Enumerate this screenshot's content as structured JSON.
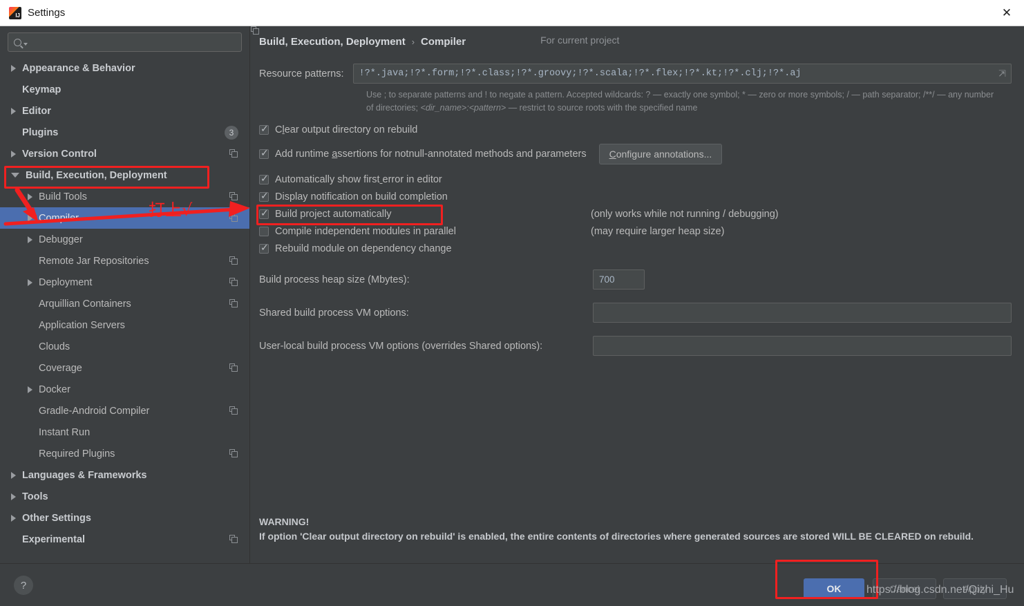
{
  "window": {
    "title": "Settings",
    "logo_icon": "intellij-idea-logo",
    "close_icon": "close-icon"
  },
  "sidebar": {
    "search": {
      "placeholder": "",
      "value": "",
      "icon": "search-icon"
    },
    "items": [
      {
        "label": "Appearance & Behavior",
        "indent": 0,
        "arrow": "right",
        "bold": true,
        "badge": null,
        "copy": false,
        "selected": false
      },
      {
        "label": "Keymap",
        "indent": 0,
        "arrow": "none",
        "bold": true,
        "badge": null,
        "copy": false,
        "selected": false
      },
      {
        "label": "Editor",
        "indent": 0,
        "arrow": "right",
        "bold": true,
        "badge": null,
        "copy": false,
        "selected": false
      },
      {
        "label": "Plugins",
        "indent": 0,
        "arrow": "none",
        "bold": true,
        "badge": "3",
        "copy": false,
        "selected": false
      },
      {
        "label": "Version Control",
        "indent": 0,
        "arrow": "right",
        "bold": true,
        "badge": null,
        "copy": true,
        "selected": false
      },
      {
        "label": "Build, Execution, Deployment",
        "indent": 0,
        "arrow": "down",
        "bold": true,
        "badge": null,
        "copy": false,
        "selected": false
      },
      {
        "label": "Build Tools",
        "indent": 1,
        "arrow": "right",
        "bold": false,
        "badge": null,
        "copy": true,
        "selected": false
      },
      {
        "label": "Compiler",
        "indent": 1,
        "arrow": "right",
        "bold": false,
        "badge": null,
        "copy": true,
        "selected": true
      },
      {
        "label": "Debugger",
        "indent": 1,
        "arrow": "right",
        "bold": false,
        "badge": null,
        "copy": false,
        "selected": false
      },
      {
        "label": "Remote Jar Repositories",
        "indent": 1,
        "arrow": "none",
        "bold": false,
        "badge": null,
        "copy": true,
        "selected": false
      },
      {
        "label": "Deployment",
        "indent": 1,
        "arrow": "right",
        "bold": false,
        "badge": null,
        "copy": true,
        "selected": false
      },
      {
        "label": "Arquillian Containers",
        "indent": 1,
        "arrow": "none",
        "bold": false,
        "badge": null,
        "copy": true,
        "selected": false
      },
      {
        "label": "Application Servers",
        "indent": 1,
        "arrow": "none",
        "bold": false,
        "badge": null,
        "copy": false,
        "selected": false
      },
      {
        "label": "Clouds",
        "indent": 1,
        "arrow": "none",
        "bold": false,
        "badge": null,
        "copy": false,
        "selected": false
      },
      {
        "label": "Coverage",
        "indent": 1,
        "arrow": "none",
        "bold": false,
        "badge": null,
        "copy": true,
        "selected": false
      },
      {
        "label": "Docker",
        "indent": 1,
        "arrow": "right",
        "bold": false,
        "badge": null,
        "copy": false,
        "selected": false
      },
      {
        "label": "Gradle-Android Compiler",
        "indent": 1,
        "arrow": "none",
        "bold": false,
        "badge": null,
        "copy": true,
        "selected": false
      },
      {
        "label": "Instant Run",
        "indent": 1,
        "arrow": "none",
        "bold": false,
        "badge": null,
        "copy": false,
        "selected": false
      },
      {
        "label": "Required Plugins",
        "indent": 1,
        "arrow": "none",
        "bold": false,
        "badge": null,
        "copy": true,
        "selected": false
      },
      {
        "label": "Languages & Frameworks",
        "indent": 0,
        "arrow": "right",
        "bold": true,
        "badge": null,
        "copy": false,
        "selected": false
      },
      {
        "label": "Tools",
        "indent": 0,
        "arrow": "right",
        "bold": true,
        "badge": null,
        "copy": false,
        "selected": false
      },
      {
        "label": "Other Settings",
        "indent": 0,
        "arrow": "right",
        "bold": true,
        "badge": null,
        "copy": false,
        "selected": false
      },
      {
        "label": "Experimental",
        "indent": 0,
        "arrow": "none",
        "bold": true,
        "badge": null,
        "copy": true,
        "selected": false
      }
    ]
  },
  "panel": {
    "breadcrumb_root": "Build, Execution, Deployment",
    "breadcrumb_sep": "›",
    "breadcrumb_leaf": "Compiler",
    "for_current_project": "For current project",
    "resource_patterns_label": "Resource patterns:",
    "resource_patterns_value": "!?*.java;!?*.form;!?*.class;!?*.groovy;!?*.scala;!?*.flex;!?*.kt;!?*.clj;!?*.aj",
    "expand_icon": "expand-field-icon",
    "hint_line1": "Use ; to separate patterns and ! to negate a pattern. Accepted wildcards: ? — exactly one symbol; * — zero or more symbols; / — path",
    "hint_line2_a": "separator; /**/ — any number of directories; ",
    "hint_line2_italic": "<dir_name>:<pattern>",
    "hint_line2_b": " — restrict to source roots with the specified name",
    "checkboxes": [
      {
        "label": "Clear output directory on rebuild",
        "checked": true,
        "note": ""
      },
      {
        "label": "Add runtime assertions for notnull-annotated methods and parameters",
        "checked": true,
        "note": ""
      },
      {
        "label": "Automatically show first error in editor",
        "checked": true,
        "note": ""
      },
      {
        "label": "Display notification on build completion",
        "checked": true,
        "note": ""
      },
      {
        "label": "Build project automatically",
        "checked": true,
        "note": "(only works while not running / debugging)"
      },
      {
        "label": "Compile independent modules in parallel",
        "checked": false,
        "note": "(may require larger heap size)"
      },
      {
        "label": "Rebuild module on dependency change",
        "checked": true,
        "note": ""
      }
    ],
    "configure_annotations_button": "Configure annotations...",
    "heap_label": "Build process heap size (Mbytes):",
    "heap_value": "700",
    "shared_vm_label": "Shared build process VM options:",
    "shared_vm_value": "",
    "userlocal_vm_label": "User-local build process VM options (overrides Shared options):",
    "userlocal_vm_value": "",
    "warning_title": "WARNING!",
    "warning_body": "If option 'Clear output directory on rebuild' is enabled, the entire contents of directories where generated sources are stored WILL BE CLEARED on rebuild."
  },
  "footer": {
    "help_label": "?",
    "ok": "OK",
    "cancel": "Cancel",
    "apply": "Apply"
  },
  "annotations": {
    "chinese_note": "打上√",
    "watermark": "https://blog.csdn.net/Qizhi_Hu",
    "highlight_color": "#f02020"
  }
}
